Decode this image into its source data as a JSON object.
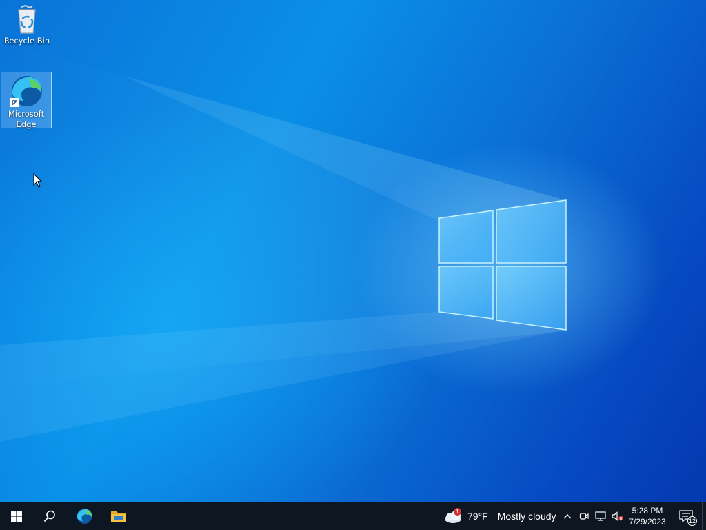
{
  "desktop": {
    "icons": [
      {
        "label": "Recycle Bin",
        "icon": "recycle-bin-icon"
      },
      {
        "label": "Microsoft Edge",
        "icon": "edge-icon"
      }
    ]
  },
  "taskbar": {
    "start_icon": "windows-logo-icon",
    "search_icon": "search-icon",
    "pinned": [
      {
        "name": "Microsoft Edge",
        "icon": "edge-icon"
      },
      {
        "name": "File Explorer",
        "icon": "folder-icon"
      }
    ],
    "weather": {
      "temperature": "79°F",
      "condition": "Mostly cloudy",
      "alert_count": "1"
    },
    "tray": {
      "chevron_icon": "chevron-up-icon",
      "meet_icon": "meet-now-icon",
      "network_icon": "network-icon",
      "volume_icon": "volume-muted-icon"
    },
    "clock": {
      "time": "5:28 PM",
      "date": "7/29/2023"
    },
    "notifications": {
      "icon": "action-center-icon",
      "count": "12"
    }
  },
  "colors": {
    "taskbar_bg": "#0e1621",
    "wallpaper_blue": "#0a73d8",
    "edge_blue": "#0c59a4",
    "edge_green": "#5fd063",
    "folder_yellow": "#f5c242",
    "alert_red": "#d13438"
  }
}
